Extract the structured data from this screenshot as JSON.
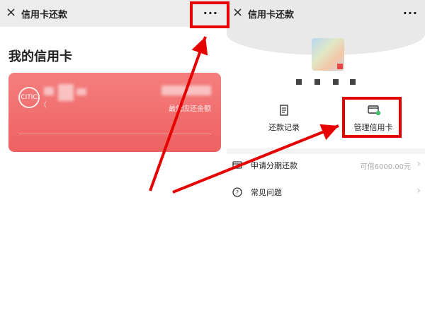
{
  "left": {
    "topbar": {
      "close_icon": "×",
      "title": "信用卡还款",
      "more_icon": "···"
    },
    "section_title": "我的信用卡",
    "card": {
      "logo_text": "CITIC",
      "number_blur": "",
      "sub_label": "(",
      "min_pay_label": "最低应还金额"
    }
  },
  "right": {
    "topbar": {
      "close_icon": "×",
      "title": "信用卡还款",
      "more_icon": "···"
    },
    "actions": [
      {
        "label": "还款记录",
        "icon": "receipt-icon"
      },
      {
        "label": "管理信用卡",
        "icon": "card-manage-icon"
      }
    ],
    "rows": [
      {
        "label": "申请分期还款",
        "value": "可借6000.00元",
        "icon": "installment-icon"
      },
      {
        "label": "常见问题",
        "value": "",
        "icon": "help-icon"
      }
    ]
  },
  "annotation_color": "#e60000"
}
